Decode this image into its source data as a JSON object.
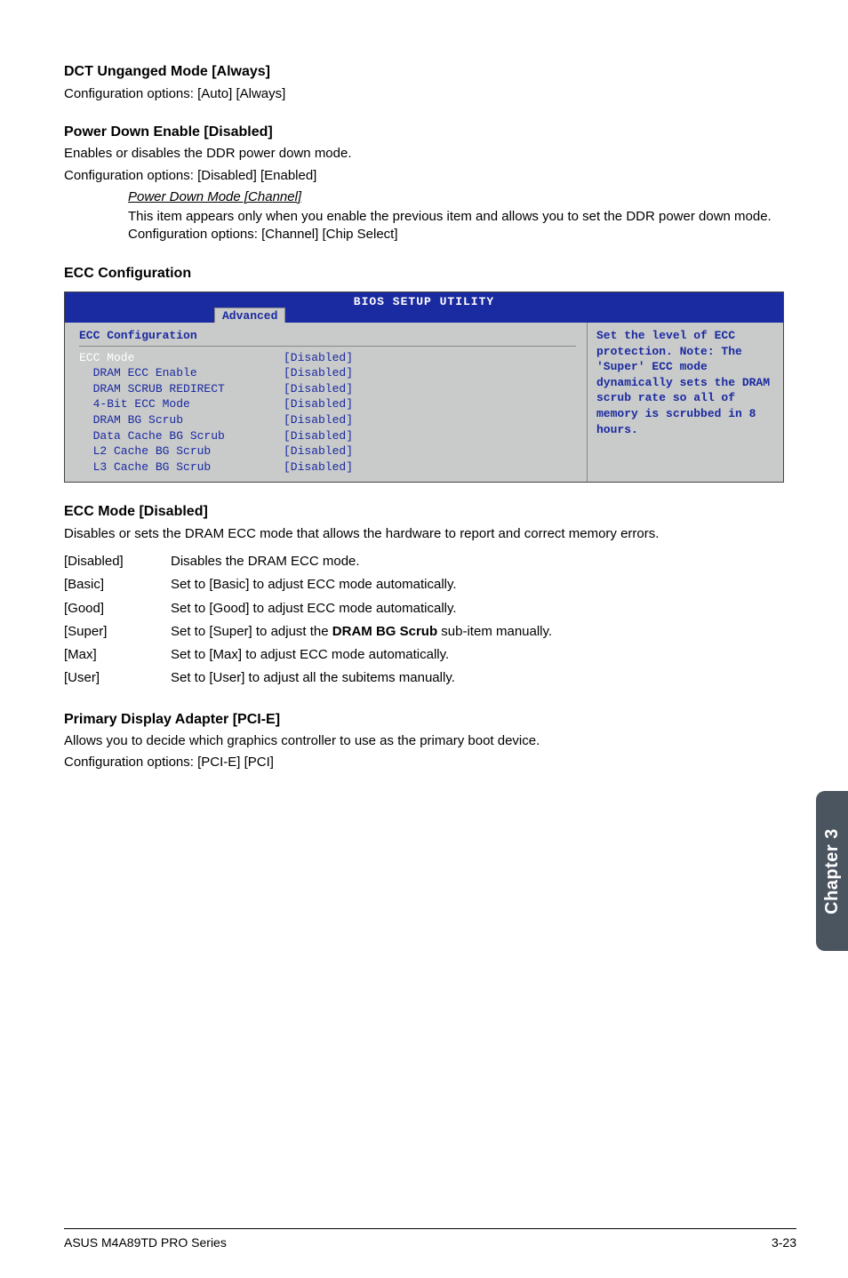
{
  "s1": {
    "heading": "DCT Unganged Mode [Always]",
    "text": "Configuration options: [Auto] [Always]"
  },
  "s2": {
    "heading": "Power Down Enable [Disabled]",
    "text1": "Enables or disables the DDR power down mode.",
    "text2": "Configuration options: [Disabled] [Enabled]",
    "sub_heading": "Power Down Mode [Channel]",
    "sub_text": "This item appears only when you enable the previous item and allows you to set the DDR power down mode. Configuration options: [Channel] [Chip Select]"
  },
  "s3": {
    "heading": "ECC Configuration"
  },
  "bios": {
    "title": "BIOS SETUP UTILITY",
    "tab": "Advanced",
    "left_heading": "ECC Configuration",
    "rows": [
      {
        "label": "ECC Mode",
        "value": "[Disabled]",
        "hl": true
      },
      {
        "label": "  DRAM ECC Enable",
        "value": "[Disabled]",
        "hl": false
      },
      {
        "label": "  DRAM SCRUB REDIRECT",
        "value": "[Disabled]",
        "hl": false
      },
      {
        "label": "  4-Bit ECC Mode",
        "value": "[Disabled]",
        "hl": false
      },
      {
        "label": "  DRAM BG Scrub",
        "value": "[Disabled]",
        "hl": false
      },
      {
        "label": "  Data Cache BG Scrub",
        "value": "[Disabled]",
        "hl": false
      },
      {
        "label": "  L2 Cache BG Scrub",
        "value": "[Disabled]",
        "hl": false
      },
      {
        "label": "  L3 Cache BG Scrub",
        "value": "[Disabled]",
        "hl": false
      }
    ],
    "help": "Set the level of ECC protection. Note: The 'Super' ECC mode dynamically sets the DRAM scrub rate so all of memory is scrubbed in 8 hours."
  },
  "s4": {
    "heading": "ECC Mode [Disabled]",
    "text": "Disables or sets the DRAM ECC mode that allows the hardware to report and correct memory errors.",
    "rows": [
      {
        "k": "[Disabled]",
        "v": "Disables the DRAM ECC mode."
      },
      {
        "k": "[Basic]",
        "v": "Set to [Basic] to adjust ECC mode automatically."
      },
      {
        "k": "[Good]",
        "v": "Set to [Good] to adjust ECC mode automatically."
      },
      {
        "k": "[Super]",
        "v_pre": "Set to [Super] to adjust the ",
        "v_bold": "DRAM BG Scrub",
        "v_post": " sub-item manually."
      },
      {
        "k": "[Max]",
        "v": "Set to [Max] to adjust ECC mode automatically."
      },
      {
        "k": "[User]",
        "v": "Set to [User] to adjust all the subitems manually."
      }
    ]
  },
  "s5": {
    "heading": "Primary Display Adapter [PCI-E]",
    "text1": "Allows you to decide which graphics controller to use as the primary boot device.",
    "text2": "Configuration options: [PCI-E] [PCI]"
  },
  "side_tab": "Chapter 3",
  "footer": {
    "left": "ASUS M4A89TD PRO Series",
    "right": "3-23"
  }
}
